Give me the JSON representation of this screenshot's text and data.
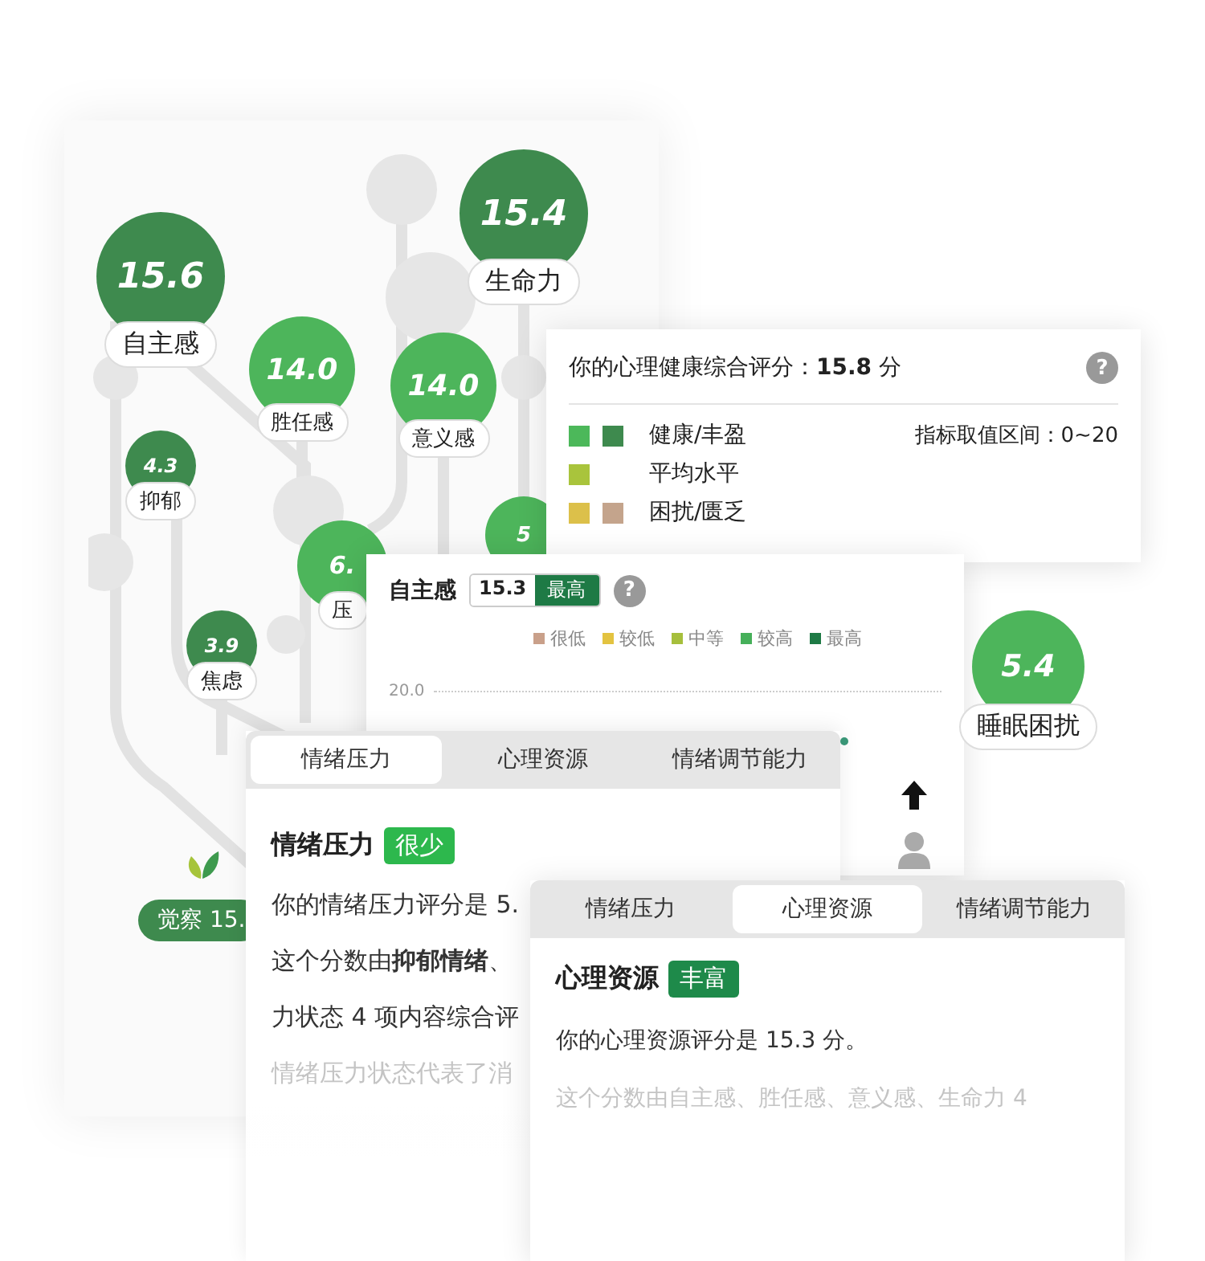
{
  "tree": {
    "nodes": [
      {
        "value": "15.6",
        "label": "自主感",
        "color": "#3e8a4e"
      },
      {
        "value": "15.4",
        "label": "生命力",
        "color": "#3e8a4e"
      },
      {
        "value": "14.0",
        "label": "胜任感",
        "color": "#4db55b"
      },
      {
        "value": "14.0",
        "label": "意义感",
        "color": "#4db55b"
      },
      {
        "value": "4.3",
        "label": "抑郁",
        "color": "#3e8a4e"
      },
      {
        "value": "3.9",
        "label": "焦虑",
        "color": "#3e8a4e"
      },
      {
        "value": "6.",
        "label": "压",
        "color": "#4db55b"
      },
      {
        "value": "5",
        "color": "#4db55b"
      },
      {
        "value": "5.4",
        "label": "睡眠困扰",
        "color": "#4db55b"
      }
    ],
    "awareness": {
      "label": "觉察 15."
    }
  },
  "summary_card": {
    "title": "你的心理健康综合评分：**15.8** 分",
    "help": "?",
    "legend": [
      {
        "label": "健康/丰盈",
        "swatches": [
          {
            "color": "#4cb85a"
          },
          {
            "color": "#3e8a4e"
          }
        ]
      },
      {
        "label": "平均水平",
        "swatches": [
          {
            "color": "#a9c43c"
          }
        ]
      },
      {
        "label": "困扰/匮乏",
        "swatches": [
          {
            "color": "#dcc04a"
          },
          {
            "color": "#c4a48c"
          }
        ]
      }
    ],
    "range": "指标取值区间：0~20"
  },
  "detail_card": {
    "title": "自主感",
    "score": "15.3",
    "badge": "最高",
    "help": "?",
    "legend": [
      {
        "label": "很低",
        "color": "#c9a08a"
      },
      {
        "label": "较低",
        "color": "#e3c340"
      },
      {
        "label": "中等",
        "color": "#a6bf3c"
      },
      {
        "label": "较高",
        "color": "#46b05a"
      },
      {
        "label": "最高",
        "color": "#1e7a45"
      }
    ],
    "y_tick": "20.0"
  },
  "stress_card": {
    "tabs": [
      {
        "label": "情绪压力",
        "selected": true
      },
      {
        "label": "心理资源",
        "selected": false
      },
      {
        "label": "情绪调节能力",
        "selected": false
      }
    ],
    "title": "情绪压力",
    "badge": {
      "label": "很少",
      "color": "#2db84d"
    },
    "lines": [
      {
        "text": "你的情绪压力评分是 5.",
        "faded": false
      },
      {
        "text": "这个分数由**抑郁情绪**、",
        "faded": false
      },
      {
        "text": "力状态 4 项内容综合评",
        "faded": false
      },
      {
        "text": "情绪压力状态代表了消",
        "faded": true
      }
    ]
  },
  "resource_card": {
    "tabs": [
      {
        "label": "情绪压力",
        "selected": false
      },
      {
        "label": "心理资源",
        "selected": true
      },
      {
        "label": "情绪调节能力",
        "selected": false
      }
    ],
    "title": "心理资源",
    "badge": {
      "label": "丰富",
      "color": "#1e8a4a"
    },
    "lines": [
      {
        "text": "你的心理资源评分是 15.3 分。",
        "faded": false
      },
      {
        "text": "这个分数由自主感、胜任感、意义感、生命力 4",
        "faded": true
      }
    ]
  }
}
